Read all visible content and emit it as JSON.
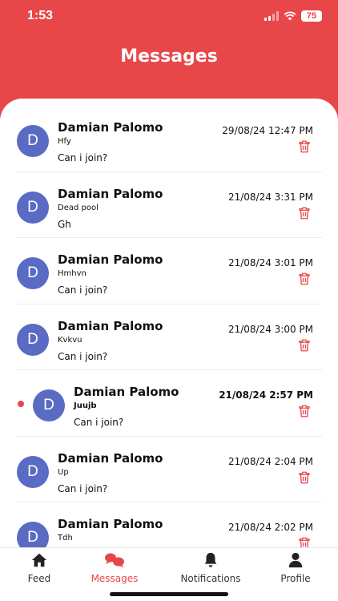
{
  "status_bar": {
    "time": "1:53",
    "battery": "75"
  },
  "header": {
    "title": "Messages"
  },
  "messages": [
    {
      "name": "Damian Palomo",
      "initial": "D",
      "subject": "Hfy",
      "preview": "Can i join?",
      "date": "29/08/24 12:47 PM",
      "unread": false
    },
    {
      "name": "Damian Palomo",
      "initial": "D",
      "subject": "Dead pool",
      "preview": "Gh",
      "date": "21/08/24 3:31 PM",
      "unread": false
    },
    {
      "name": "Damian Palomo",
      "initial": "D",
      "subject": "Hmhvn",
      "preview": "Can i join?",
      "date": "21/08/24 3:01 PM",
      "unread": false
    },
    {
      "name": "Damian Palomo",
      "initial": "D",
      "subject": "Kvkvu",
      "preview": "Can i join?",
      "date": "21/08/24 3:00 PM",
      "unread": false
    },
    {
      "name": "Damian Palomo",
      "initial": "D",
      "subject": "Juujb",
      "preview": "Can i join?",
      "date": "21/08/24 2:57 PM",
      "unread": true
    },
    {
      "name": "Damian Palomo",
      "initial": "D",
      "subject": "Up",
      "preview": "Can i join?",
      "date": "21/08/24 2:04 PM",
      "unread": false
    },
    {
      "name": "Damian Palomo",
      "initial": "D",
      "subject": "Tdh",
      "preview": "",
      "date": "21/08/24 2:02 PM",
      "unread": false
    }
  ],
  "tabbar": {
    "active": "messages",
    "feed_label": "Feed",
    "messages_label": "Messages",
    "notifications_label": "Notifications",
    "profile_label": "Profile"
  },
  "colors": {
    "accent": "#e8474a",
    "avatar": "#5a6bc4",
    "text": "#111111"
  }
}
